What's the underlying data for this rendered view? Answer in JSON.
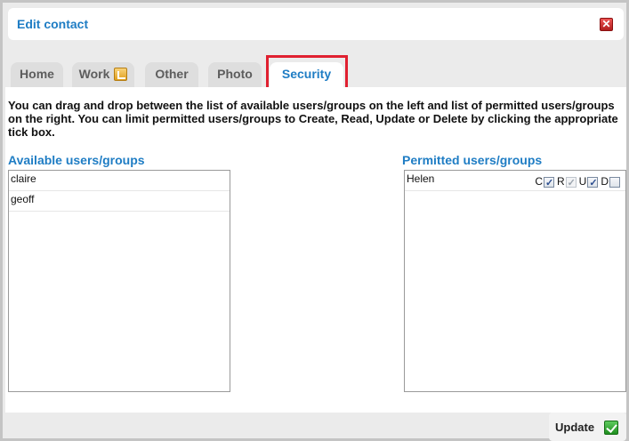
{
  "dialog": {
    "title": "Edit contact",
    "close_icon": "close-x-icon"
  },
  "tabs": [
    {
      "label": "Home",
      "active": false
    },
    {
      "label": "Work",
      "active": false,
      "icon": "edit-badge-icon"
    },
    {
      "label": "Other",
      "active": false
    },
    {
      "label": "Photo",
      "active": false
    },
    {
      "label": "Security",
      "active": true
    }
  ],
  "security": {
    "intro": "You can drag and drop between the list of available users/groups on the left and list of permitted users/groups on the right. You can limit permitted users/groups to Create, Read, Update or Delete by clicking the appropriate tick box.",
    "available_heading": "Available users/groups",
    "available": [
      "claire",
      "geoff"
    ],
    "permitted_heading": "Permitted users/groups",
    "permitted": [
      {
        "name": "Helen",
        "perms": [
          {
            "letter": "C",
            "checked": true,
            "disabled": false
          },
          {
            "letter": "R",
            "checked": true,
            "disabled": true
          },
          {
            "letter": "U",
            "checked": true,
            "disabled": false
          },
          {
            "letter": "D",
            "checked": false,
            "disabled": false
          }
        ]
      }
    ]
  },
  "footer": {
    "update_label": "Update",
    "update_icon": "checkmark-icon"
  },
  "colors": {
    "accent": "#1f7dc4",
    "highlight": "#e02030"
  }
}
